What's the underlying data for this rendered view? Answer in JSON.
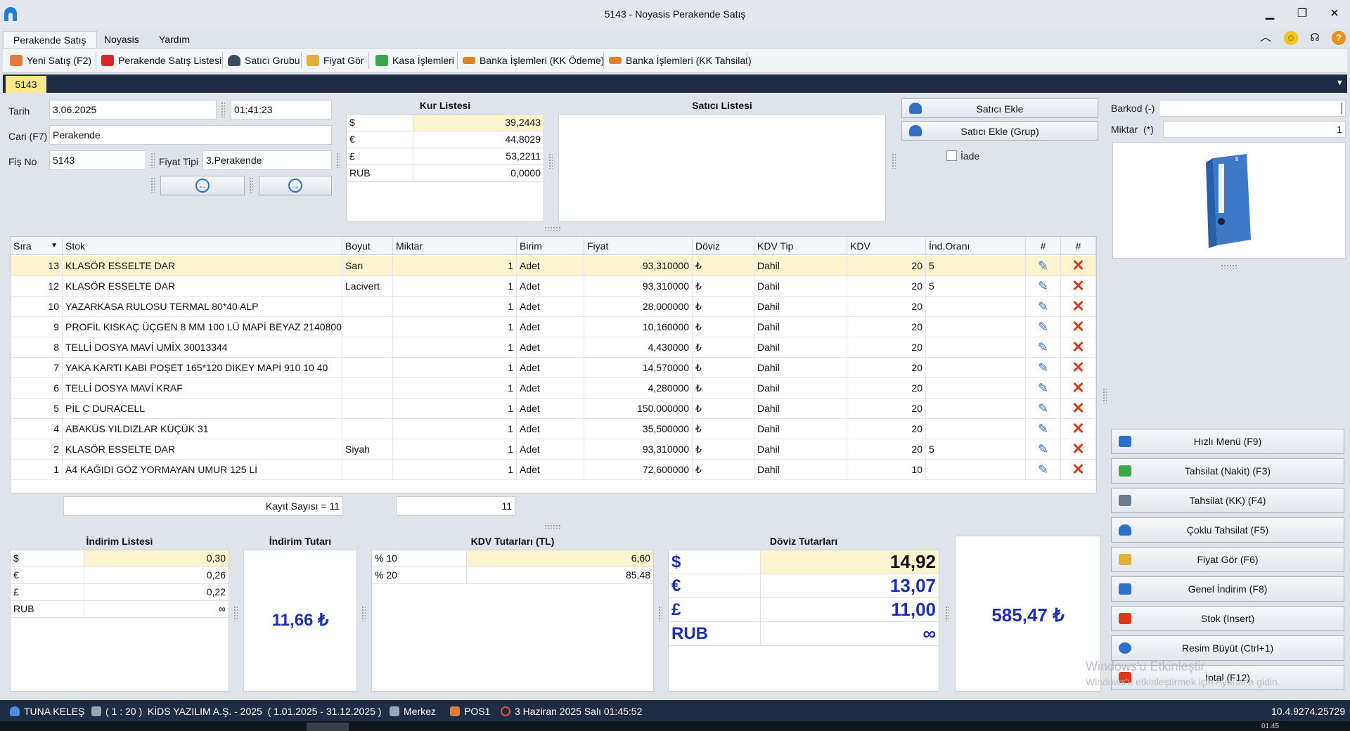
{
  "window": {
    "title": "5143 - Noyasis Perakende Satış",
    "minimize": "▁",
    "restore": "❐",
    "close": "✕"
  },
  "menu_tabs": [
    "Perakende Satış",
    "Noyasis",
    "Yardım"
  ],
  "toolbar": [
    {
      "label": "Yeni Satış (F2)",
      "icon": "hand-icon",
      "color": "#e07b3a"
    },
    {
      "label": "Perakende Satış Listesi",
      "icon": "cart-icon",
      "color": "#d62a2a"
    },
    {
      "label": "Satıcı Grubu",
      "icon": "user-icon",
      "color": "#3a4a63"
    },
    {
      "label": "Fiyat Gör",
      "icon": "price-icon",
      "color": "#e3b13b"
    },
    {
      "label": "Kasa İşlemleri",
      "icon": "cash-icon",
      "color": "#3aa84a"
    },
    {
      "label": "Banka İşlemleri (KK Ödeme)",
      "icon": "card-icon",
      "color": "#e0812a"
    },
    {
      "label": "Banka İşlemleri (KK Tahsilat)",
      "icon": "card-icon",
      "color": "#e0812a"
    }
  ],
  "doc_tab": "5143",
  "form": {
    "tarih_label": "Tarih",
    "tarih": "3.06.2025",
    "saat": "01:41:23",
    "cari_label": "Cari (F7)",
    "cari": "Perakende",
    "fis_label": "Fiş No",
    "fis": "5143",
    "fiyat_tipi_label": "Fiyat Tipi",
    "fiyat_tipi": "3.Perakende",
    "prev_glyph": "←",
    "next_glyph": "→"
  },
  "kur": {
    "title": "Kur Listesi",
    "rows": [
      {
        "k": "$",
        "v": "39,2443"
      },
      {
        "k": "€",
        "v": "44,8029"
      },
      {
        "k": "£",
        "v": "53,2211"
      },
      {
        "k": "RUB",
        "v": "0,0000"
      }
    ]
  },
  "satici": {
    "title": "Satıcı Listesi",
    "add": "Satıcı Ekle",
    "add_group": "Satıcı Ekle (Grup)",
    "iade": "İade"
  },
  "barkod": {
    "label": "Barkod (-)",
    "value": ""
  },
  "miktar": {
    "label": "Miktar",
    "star": "(*)",
    "value": "1"
  },
  "grid": {
    "headers": [
      "Sıra",
      "Stok",
      "Boyut",
      "Miktar",
      "Birim",
      "Fiyat",
      "Döviz",
      "KDV Tip",
      "KDV",
      "İnd.Oranı",
      "#",
      "#"
    ],
    "rows": [
      [
        "13",
        "KLASÖR ESSELTE DAR",
        "Sarı",
        "1",
        "Adet",
        "93,310000",
        "₺",
        "Dahil",
        "20",
        "5"
      ],
      [
        "12",
        "KLASÖR ESSELTE DAR",
        "Lacivert",
        "1",
        "Adet",
        "93,310000",
        "₺",
        "Dahil",
        "20",
        "5"
      ],
      [
        "10",
        "YAZARKASA RULOSU TERMAL 80*40 ALP",
        "",
        "1",
        "Adet",
        "28,000000",
        "₺",
        "Dahil",
        "20",
        ""
      ],
      [
        "9",
        "PROFİL KISKAÇ ÜÇGEN 8 MM 100 LÜ MAPİ BEYAZ 2140800",
        "",
        "1",
        "Adet",
        "10,160000",
        "₺",
        "Dahil",
        "20",
        ""
      ],
      [
        "8",
        "TELLİ DOSYA MAVİ UMİX 30013344",
        "",
        "1",
        "Adet",
        "4,430000",
        "₺",
        "Dahil",
        "20",
        ""
      ],
      [
        "7",
        "YAKA KARTI KABI POŞET 165*120 DİKEY MAPİ 910 10 40",
        "",
        "1",
        "Adet",
        "14,570000",
        "₺",
        "Dahil",
        "20",
        ""
      ],
      [
        "6",
        "TELLİ DOSYA MAVİ KRAF",
        "",
        "1",
        "Adet",
        "4,280000",
        "₺",
        "Dahil",
        "20",
        ""
      ],
      [
        "5",
        "PİL C DURACELL",
        "",
        "1",
        "Adet",
        "150,000000",
        "₺",
        "Dahil",
        "20",
        ""
      ],
      [
        "4",
        "ABAKÜS YILDIZLAR KÜÇÜK 31",
        "",
        "1",
        "Adet",
        "35,500000",
        "₺",
        "Dahil",
        "20",
        ""
      ],
      [
        "2",
        "KLASÖR ESSELTE DAR",
        "Siyah",
        "1",
        "Adet",
        "93,310000",
        "₺",
        "Dahil",
        "20",
        "5"
      ],
      [
        "1",
        "A4 KAĞIDI GÖZ YORMAYAN UMUR 125 Lİ",
        "",
        "1",
        "Adet",
        "72,600000",
        "₺",
        "Dahil",
        "10",
        ""
      ]
    ],
    "kayit": "Kayıt Sayısı = 11",
    "miktar_total": "11",
    "edit_glyph": "✎",
    "delete_glyph": "✕"
  },
  "indirim": {
    "title": "İndirim Listesi",
    "rows": [
      {
        "k": "$",
        "v": "0,30"
      },
      {
        "k": "€",
        "v": "0,26"
      },
      {
        "k": "£",
        "v": "0,22"
      },
      {
        "k": "RUB",
        "v": "∞"
      }
    ]
  },
  "indirim_tutari": {
    "title": "İndirim Tutarı",
    "value": "11,66 ₺"
  },
  "kdv": {
    "title": "KDV Tutarları (TL)",
    "rows": [
      {
        "k": "% 10",
        "v": "6,60"
      },
      {
        "k": "% 20",
        "v": "85,48"
      }
    ]
  },
  "doviz": {
    "title": "Döviz Tutarları",
    "rows": [
      {
        "k": "$",
        "v": "14,92"
      },
      {
        "k": "€",
        "v": "13,07"
      },
      {
        "k": "£",
        "v": "11,00"
      },
      {
        "k": "RUB",
        "v": "∞"
      }
    ]
  },
  "toplam": "585,47 ₺",
  "side_buttons": [
    {
      "label": "Hızlı Menü (F9)",
      "icon": "grid-icon",
      "color": "#2f6fc7"
    },
    {
      "label": "Tahsilat (Nakit) (F3)",
      "icon": "cash-icon",
      "color": "#3aa84a"
    },
    {
      "label": "Tahsilat (KK) (F4)",
      "icon": "card-icon",
      "color": "#6b7a90"
    },
    {
      "label": "Çoklu Tahsilat (F5)",
      "icon": "user-icon",
      "color": "#2f6fc7"
    },
    {
      "label": "Fiyat Gör (F6)",
      "icon": "price-icon",
      "color": "#e3b13b"
    },
    {
      "label": "Genel İndirim (F8)",
      "icon": "tag-icon",
      "color": "#2f6fc7"
    },
    {
      "label": "Stok (Insert)",
      "icon": "cart-icon",
      "color": "#d9391b"
    },
    {
      "label": "Resim Büyüt (Ctrl+1)",
      "icon": "magnifier-icon",
      "color": "#2f6fc7"
    },
    {
      "label": "İptal (F12)",
      "icon": "cancel-icon",
      "color": "#d9391b"
    }
  ],
  "watermark": {
    "line1": "Windows'u Etkinleştir",
    "line2": "Windows'u etkinleştirmek için Ayarlar'a gidin."
  },
  "status": {
    "user": "TUNA KELEŞ",
    "company": "( 1 : 20 )  KİDS YAZILIM A.Ş. - 2025  ( 1.01.2025 - 31.12.2025 )",
    "branch": "Merkez",
    "pos": "POS1",
    "datetime": "3 Haziran 2025 Salı 01:45:52",
    "version": "10.4.9274.25729"
  },
  "taskbar_clock": "01:45"
}
